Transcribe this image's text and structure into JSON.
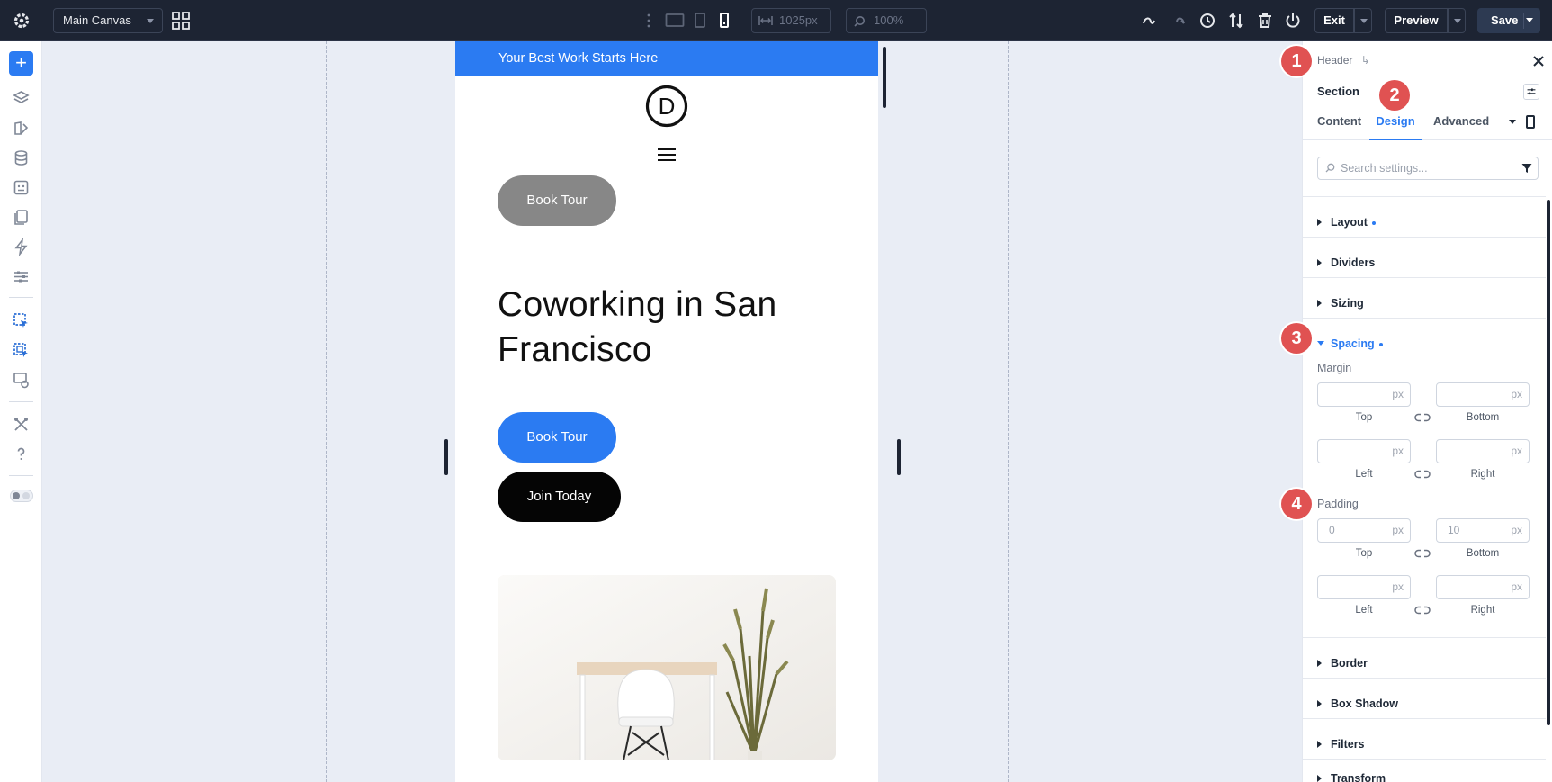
{
  "topbar": {
    "canvas_select": "Main Canvas",
    "width_value": "1025px",
    "zoom_value": "100%",
    "exit_label": "Exit",
    "preview_label": "Preview",
    "save_label": "Save"
  },
  "page": {
    "banner_text": "Your Best Work Starts Here",
    "logo_letter": "D",
    "top_button": "Book Tour",
    "headline": "Coworking in San Francisco",
    "primary_button": "Book Tour",
    "secondary_button": "Join Today"
  },
  "panel": {
    "breadcrumb": "Header",
    "breadcrumb_icon": "↳",
    "module_title": "Section",
    "tabs": [
      "Content",
      "Design",
      "Advanced"
    ],
    "active_tab": "Design",
    "search_placeholder": "Search settings...",
    "groups": {
      "layout": "Layout",
      "dividers": "Dividers",
      "sizing": "Sizing",
      "spacing": "Spacing",
      "border": "Border",
      "box_shadow": "Box Shadow",
      "filters": "Filters",
      "transform": "Transform"
    },
    "margin": {
      "label": "Margin",
      "top": "",
      "bottom": "",
      "left": "",
      "right": "",
      "unit": "px",
      "captions": {
        "top": "Top",
        "bottom": "Bottom",
        "left": "Left",
        "right": "Right"
      }
    },
    "padding": {
      "label": "Padding",
      "top": "0",
      "bottom": "10",
      "left": "",
      "right": "",
      "unit": "px",
      "captions": {
        "top": "Top",
        "bottom": "Bottom",
        "left": "Left",
        "right": "Right"
      }
    }
  },
  "badges": [
    "1",
    "2",
    "3",
    "4"
  ],
  "colors": {
    "accent": "#2b7bf2",
    "topbar_bg": "#1d2433",
    "badge": "#e05252",
    "canvas_bg": "#e9edf5"
  }
}
